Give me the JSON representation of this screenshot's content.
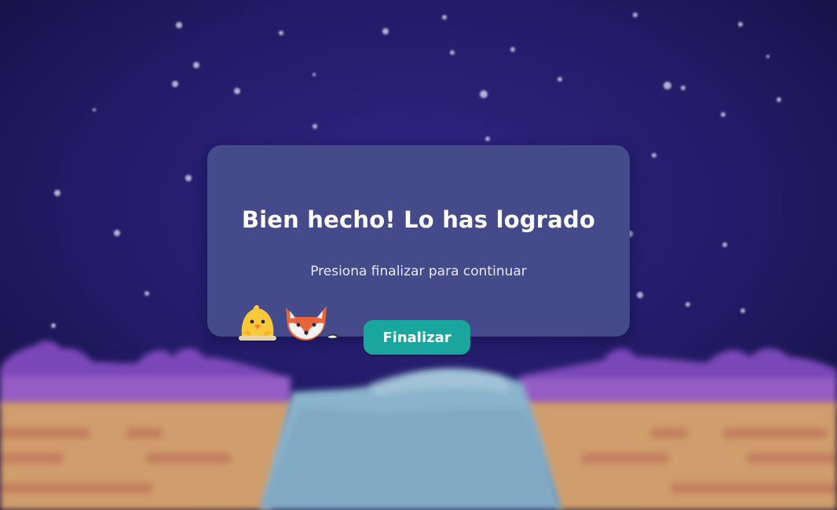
{
  "modal": {
    "title": "Bien hecho! Lo has logrado",
    "subtitle": "Presiona finalizar para continuar",
    "finish_label": "Finalizar"
  },
  "mascots": [
    "chick-icon",
    "fox-icon"
  ],
  "colors": {
    "sky_top": "#15113f",
    "sky_mid": "#2a217a",
    "modal_bg": "#444a8a",
    "button_bg": "#1aa69f",
    "cloud_purple": "#7a47b8",
    "ground": "#d09d6c",
    "water": "#8ab4cc"
  }
}
